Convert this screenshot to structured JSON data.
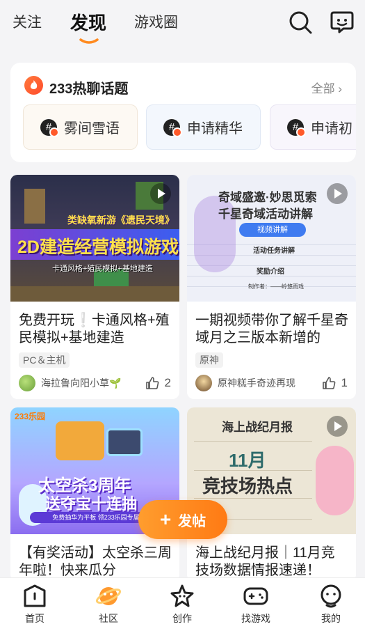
{
  "top_tabs": [
    "关注",
    "发现",
    "游戏圈"
  ],
  "active_tab": "发现",
  "icons": {
    "search": "search-icon",
    "message": "message-icon"
  },
  "hot_topics": {
    "title": "233热聊话题",
    "all_label": "全部",
    "chips": [
      "雾间雪语",
      "申请精华",
      "申请初"
    ]
  },
  "feed": [
    {
      "thumb_main": "2D建造经营模拟游戏",
      "thumb_sub": "类缺氧新游《遗民天境》",
      "thumb_caption": "卡通风格+殖民模拟+基地建造",
      "title": "免费开玩❕卡通风格+殖民模拟+基地建造",
      "tag": "PC＆主机",
      "author": "海拉鲁向阳小草🌱",
      "likes": "2",
      "has_video": true
    },
    {
      "thumb_line1": "奇域盛邀·妙思觅索",
      "thumb_line2": "千星奇域活动讲解",
      "thumb_pill": "视频讲解",
      "thumb_s1": "活动任务讲解",
      "thumb_s2": "奖励介绍",
      "thumb_s3": "制作者：——岭悠而戏",
      "title": "一期视频带你了解千星奇域月之三版本新增的",
      "tag": "原神",
      "author": "原神糕手奇迹再现",
      "likes": "1",
      "has_video": true
    },
    {
      "thumb_logo": "233乐园",
      "thumb_big": "太空杀3周年",
      "thumb_mid": "送夺宝十连抽",
      "thumb_foot": "免费抽华为平板 领233乐园专属",
      "title": "【有奖活动】太空杀三周年啦！快来瓜分",
      "has_video": false
    },
    {
      "thumb_head": "海上战纪月报",
      "thumb_m1": "11月",
      "thumb_m2": "竞技场热点",
      "title": "海上战纪月报｜11月竞技场数据情报速递！",
      "has_video": true
    }
  ],
  "fab_label": "发帖",
  "bottom_nav": [
    "首页",
    "社区",
    "创作",
    "找游戏",
    "我的"
  ],
  "active_bottom": "社区",
  "accent_color": "#ff8a1f"
}
